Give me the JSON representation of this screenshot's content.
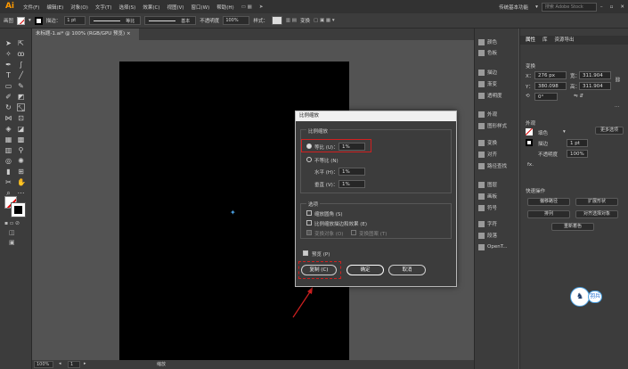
{
  "menubar": {
    "logo": "Ai",
    "items": [
      "文件(F)",
      "编辑(E)",
      "对象(O)",
      "文字(T)",
      "选择(S)",
      "效果(C)",
      "视图(V)",
      "窗口(W)",
      "帮助(H)"
    ],
    "workspace": "传统基本功能",
    "search_placeholder": "搜索 Adobe Stock"
  },
  "controlbar": {
    "mode": "画图",
    "stroke_label": "描边：",
    "stroke_value": "1 pt",
    "brush1": "等比",
    "brush2": "基本",
    "opacity_label": "不透明度",
    "opacity_value": "100%",
    "style_label": "样式：",
    "transform_label": "变换"
  },
  "document": {
    "tab_title": "未标题-1.ai* @ 100% (RGB/GPU 预览)",
    "zoom": "100%",
    "page": "1",
    "status": "缩放"
  },
  "panel_strip": {
    "items": [
      "颜色",
      "色板",
      "描边",
      "渐变",
      "透明度",
      "外观",
      "图形样式",
      "变换",
      "对齐",
      "路径查找",
      "图层",
      "画板",
      "符号",
      "字符",
      "段落",
      "OpenT..."
    ]
  },
  "properties": {
    "tabs": [
      "属性",
      "库",
      "资源导出"
    ],
    "section_transform": "变换",
    "x_label": "X：",
    "x_value": "276 px",
    "y_label": "Y：",
    "y_value": "380.098",
    "w_label": "宽：",
    "w_value": "311.904",
    "h_label": "高：",
    "h_value": "311.904",
    "rotate_value": "0°",
    "section_appearance": "外观",
    "stroke_label": "描边",
    "stroke_value": "1 pt",
    "fill_label": "填色",
    "opacity_label": "不透明度",
    "opacity_value": "100%",
    "fx_label": "fx.",
    "section_quick": "快速操作",
    "btn_offset": "偏移路径",
    "btn_expand": "扩展形状",
    "btn_arrange": "排列",
    "btn_align": "对齐选择对象",
    "btn_recolor": "重新着色",
    "btn_more": "更多选项",
    "watermark": "羽兵"
  },
  "dialog": {
    "title": "比例缩放",
    "group_scale": "比例缩放",
    "uniform_label": "等比 (U)：",
    "uniform_value": "1%",
    "nonuniform_label": "不等比 (N)",
    "horizontal_label": "水平 (H)：",
    "horizontal_value": "1%",
    "vertical_label": "垂直 (V)：",
    "vertical_value": "1%",
    "group_options": "选项",
    "opt_corners": "缩放圆角 (S)",
    "opt_strokes": "比例缩放描边和效果 (E)",
    "opt_objects": "变换对象 (O)",
    "opt_patterns": "变换图案 (T)",
    "preview_label": "预览 (P)",
    "copy_button": "复制 (C)",
    "ok_button": "确定",
    "cancel_button": "取消"
  },
  "colors": {
    "annotation": "#d02020",
    "accent": "#4a9fe0"
  }
}
